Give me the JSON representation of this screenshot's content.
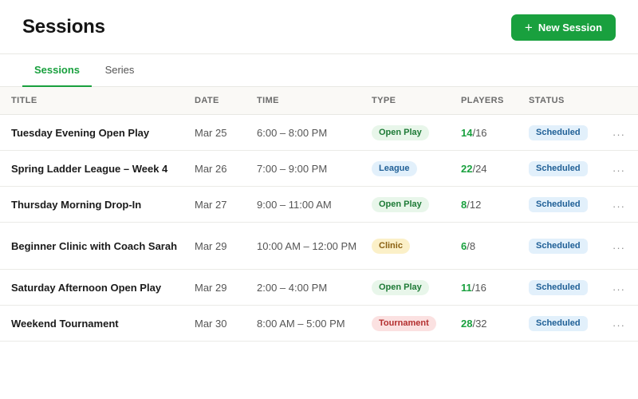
{
  "header": {
    "title": "Sessions",
    "new_button_label": "New Session",
    "new_button_icon": "plus-icon"
  },
  "tabs": [
    {
      "label": "Sessions",
      "active": true
    },
    {
      "label": "Series",
      "active": false
    }
  ],
  "table": {
    "columns": [
      "TITLE",
      "DATE",
      "TIME",
      "TYPE",
      "PLAYERS",
      "STATUS"
    ],
    "rows": [
      {
        "title": "Tuesday Evening Open Play",
        "date": "Mar 25",
        "time": "6:00 – 8:00 PM",
        "type": "Open Play",
        "players": "14",
        "capacity": "/16",
        "status": "Scheduled"
      },
      {
        "title": "Spring Ladder League – Week 4",
        "date": "Mar 26",
        "time": "7:00 – 9:00 PM",
        "type": "League",
        "players": "22",
        "capacity": "/24",
        "status": "Scheduled"
      },
      {
        "title": "Thursday Morning Drop-In",
        "date": "Mar 27",
        "time": "9:00 – 11:00 AM",
        "type": "Open Play",
        "players": "8",
        "capacity": "/12",
        "status": "Scheduled"
      },
      {
        "title": "Beginner Clinic with Coach Sarah",
        "date": "Mar 29",
        "time": "10:00 AM – 12:00 PM",
        "type": "Clinic",
        "players": "6",
        "capacity": "/8",
        "status": "Scheduled"
      },
      {
        "title": "Saturday Afternoon Open Play",
        "date": "Mar 29",
        "time": "2:00 – 4:00 PM",
        "type": "Open Play",
        "players": "11",
        "capacity": "/16",
        "status": "Scheduled"
      },
      {
        "title": "Weekend Tournament",
        "date": "Mar 30",
        "time": "8:00 AM – 5:00 PM",
        "type": "Tournament",
        "players": "28",
        "capacity": "/32",
        "status": "Scheduled"
      }
    ],
    "more_label": "···"
  },
  "colors": {
    "accent": "#19a03e",
    "type_open_play": {
      "bg": "#e8f6ea",
      "fg": "#1d7a36"
    },
    "type_league": {
      "bg": "#e2f0fb",
      "fg": "#1f5f96"
    },
    "type_clinic": {
      "bg": "#fbf0c8",
      "fg": "#8a6112"
    },
    "type_tournament": {
      "bg": "#fbe1e1",
      "fg": "#b32e2e"
    },
    "status_scheduled": {
      "bg": "#e2f0fb",
      "fg": "#1f5f96"
    }
  }
}
